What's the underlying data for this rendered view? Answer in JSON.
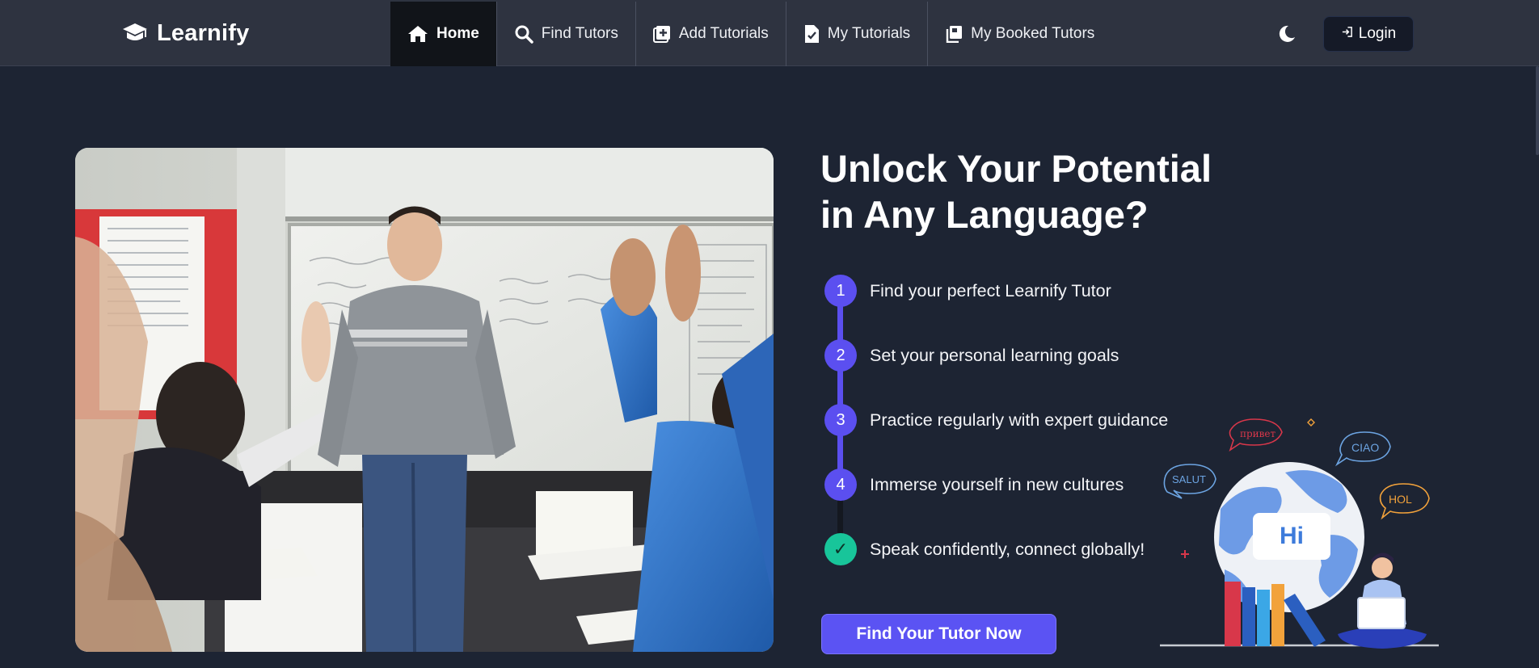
{
  "brand": {
    "name": "Learnify"
  },
  "nav": {
    "items": [
      {
        "label": "Home",
        "icon": "home-icon",
        "active": true
      },
      {
        "label": "Find Tutors",
        "icon": "search-icon",
        "active": false
      },
      {
        "label": "Add Tutorials",
        "icon": "add-square-icon",
        "active": false
      },
      {
        "label": "My Tutorials",
        "icon": "document-check-icon",
        "active": false
      },
      {
        "label": "My Booked Tutors",
        "icon": "stacked-pages-icon",
        "active": false
      }
    ]
  },
  "header": {
    "theme_icon": "moon-icon",
    "login_label": "Login",
    "login_icon": "login-arrow-icon"
  },
  "hero": {
    "headline_line1": "Unlock Your Potential",
    "headline_line2": "in Any Language?",
    "steps": [
      {
        "marker": "1",
        "text": "Find your perfect Learnify Tutor"
      },
      {
        "marker": "2",
        "text": "Set your personal learning goals"
      },
      {
        "marker": "3",
        "text": "Practice regularly with expert guidance"
      },
      {
        "marker": "4",
        "text": "Immerse yourself in new cultures"
      },
      {
        "marker": "✓",
        "text": "Speak confidently, connect globally!"
      }
    ],
    "cta_label": "Find Your Tutor Now"
  },
  "illustration": {
    "hi_text": "Hi",
    "bubbles": [
      "привет",
      "CIAO",
      "SALUT",
      "HOL"
    ]
  },
  "colors": {
    "page_bg": "#1d2433",
    "navbar_bg": "#2e3340",
    "accent": "#5b4ff0",
    "success": "#18c59a"
  }
}
